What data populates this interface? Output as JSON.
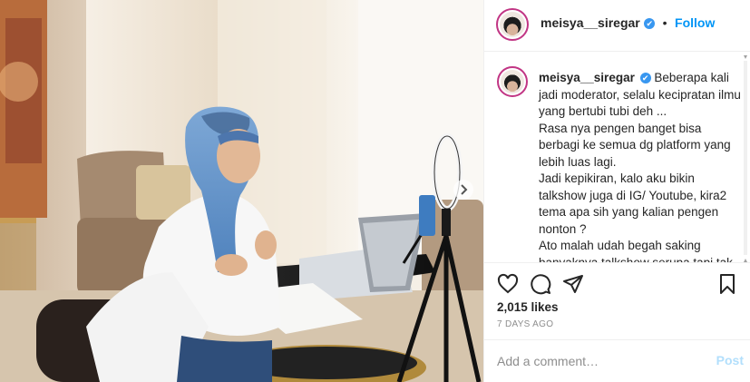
{
  "header": {
    "username": "meisya__siregar",
    "verified_badge": "✔",
    "separator": "•",
    "follow_label": "Follow"
  },
  "caption": {
    "username": "meisya__siregar",
    "verified_badge": "✔",
    "lines": [
      "Beberapa kali jadi moderator, selalu kecipratan ilmu yang bertubi tubi deh ...",
      "Rasa nya pengen banget bisa berbagi ke semua dg platform yang lebih luas lagi.",
      "Jadi kepikiran, kalo aku bikin talkshow juga di IG/ Youtube, kira2 tema apa sih yang kalian pengen nonton ?",
      "Ato malah udah begah saking banyaknya talkshow serupa tapi tak sama ?"
    ]
  },
  "icons": {
    "like": "heart-icon",
    "comment": "comment-icon",
    "share": "share-icon",
    "save": "bookmark-icon",
    "next": "chevron-right-icon"
  },
  "stats": {
    "likes": "2,015 likes",
    "age": "7 DAYS AGO"
  },
  "comment": {
    "placeholder": "Add a comment…",
    "post_label": "Post"
  },
  "colors": {
    "accent": "#0095f6",
    "verified": "#3897f0",
    "post_disabled": "#b2dffc",
    "secondary_text": "#8e8e8e"
  }
}
